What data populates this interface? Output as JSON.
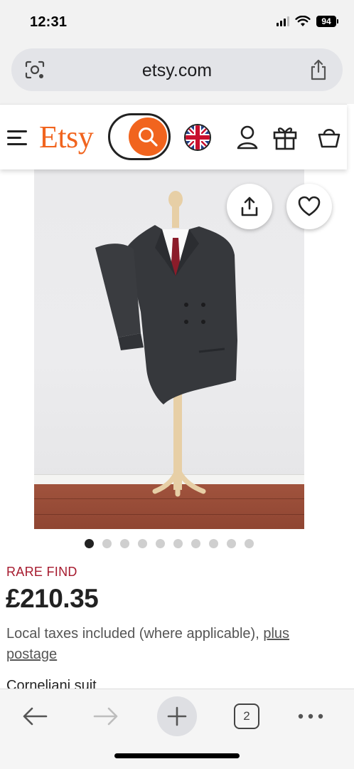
{
  "status_bar": {
    "time": "12:31",
    "battery": "94",
    "icons": [
      "signal-icon",
      "wifi-icon",
      "battery-icon"
    ]
  },
  "browser": {
    "url": "etsy.com",
    "left_icon": "page-tools-icon",
    "right_icon": "share-icon"
  },
  "header": {
    "logo": "Etsy",
    "brand_color": "#f1641e",
    "icons": [
      "menu-icon",
      "search-icon",
      "uk-flag-icon",
      "user-icon",
      "gift-icon",
      "cart-icon"
    ]
  },
  "product": {
    "image": "double-breasted-suit-on-mannequin",
    "share_icon": "share-icon",
    "favorite_icon": "heart-icon",
    "image_count": 10,
    "active_image": 1,
    "badge": "RARE FIND",
    "badge_color": "#a61a2e",
    "price": "£210.35",
    "tax_text": "Local taxes included (where applicable), ",
    "postage_link": "plus postage",
    "title": "Corneliani suit"
  },
  "toolbar": {
    "tab_count": "2",
    "icons": [
      "back-arrow-icon",
      "forward-arrow-icon",
      "plus-icon",
      "tabs-icon",
      "more-icon"
    ]
  }
}
